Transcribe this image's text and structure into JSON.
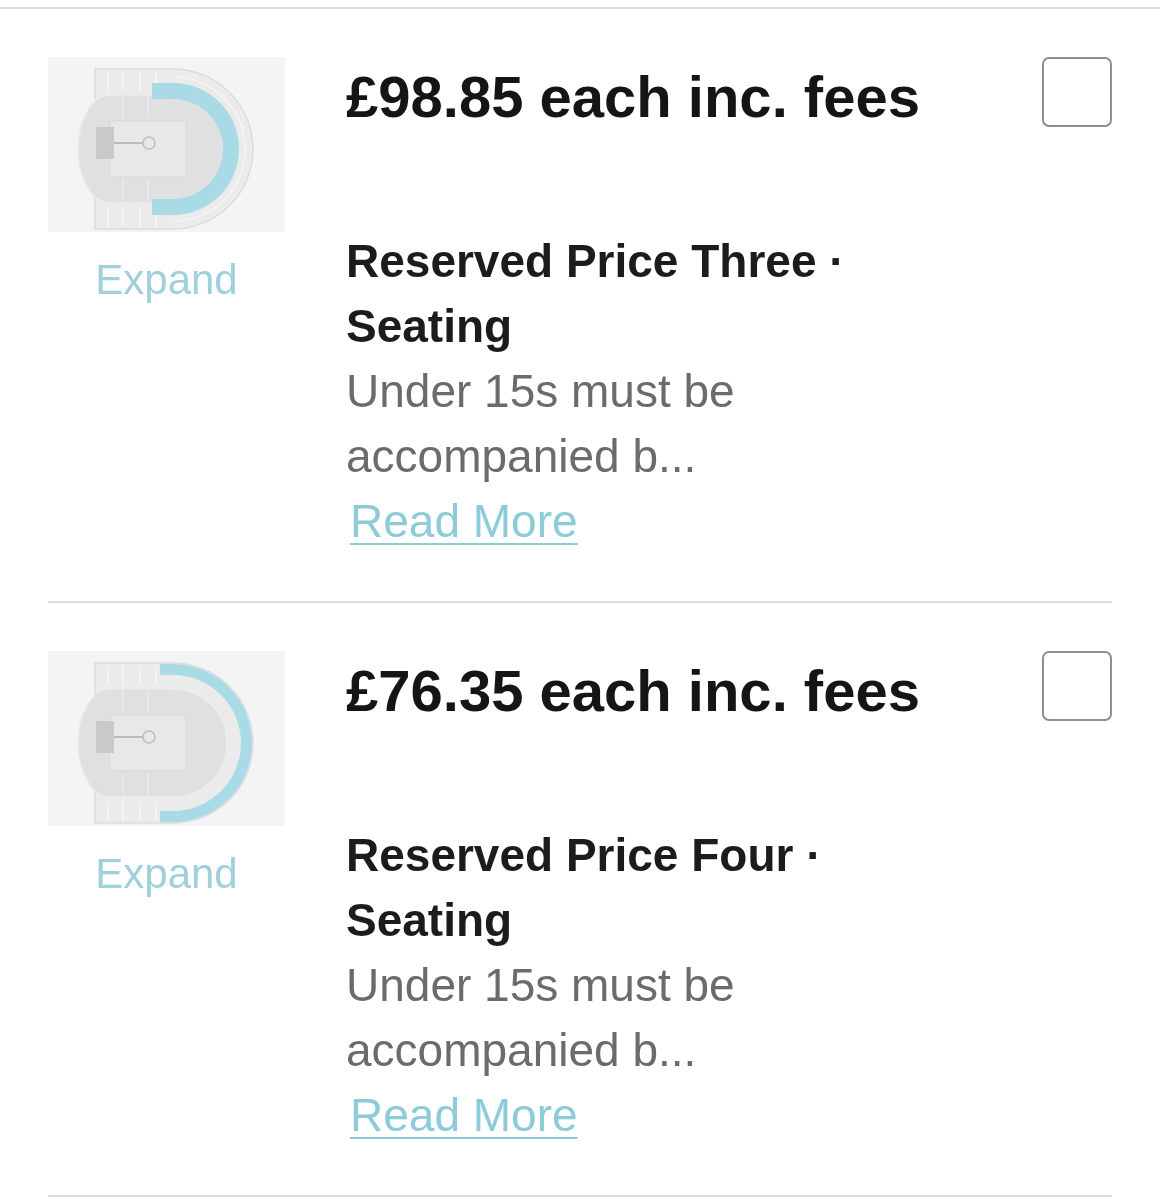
{
  "tickets": [
    {
      "map": {
        "kind": "middle"
      },
      "expand_label": "Expand",
      "price": "£98.85 each inc. fees",
      "checked": false,
      "title": "Reserved Price Three · Seating",
      "description": "Under 15s must be accompanied b...",
      "link": "Read More"
    },
    {
      "map": {
        "kind": "outer"
      },
      "expand_label": "Expand",
      "price": "£76.35 each inc. fees",
      "checked": false,
      "title": "Reserved Price Four · Seating",
      "description": "Under 15s must be accompanied b...",
      "link": "Read More"
    }
  ]
}
